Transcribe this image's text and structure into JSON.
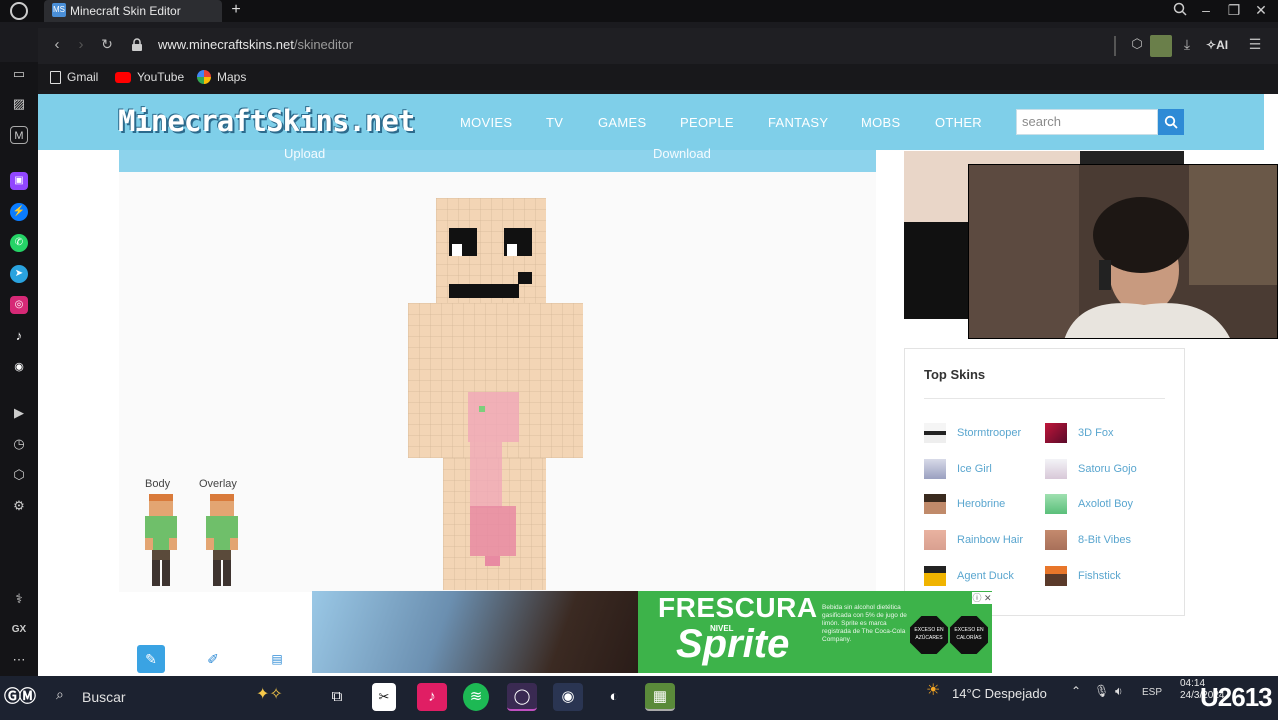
{
  "browser": {
    "tab_title": "Minecraft Skin Editor",
    "tab_favicon": "MS",
    "new_tab": "+",
    "url_domain": "www.minecraftskins.net",
    "url_path": "/skineditor",
    "ai_label": "AI",
    "bookmarks": [
      {
        "label": "Gmail",
        "color": "#d9d9d9"
      },
      {
        "label": "YouTube",
        "color": "#ff0000"
      },
      {
        "label": "Maps",
        "color": "#34a853"
      }
    ]
  },
  "site": {
    "logo": "MinecraftSkins.net",
    "nav": [
      "MOVIES",
      "TV",
      "GAMES",
      "PEOPLE",
      "FANTASY",
      "MOBS",
      "OTHER"
    ],
    "search_placeholder": "search",
    "accent": "#7fcfe9",
    "search_button_color": "#2e8bd6"
  },
  "editor": {
    "upload_label": "Upload",
    "download_label": "Download",
    "body_label": "Body",
    "overlay_label": "Overlay",
    "tools": [
      "paint-brush",
      "pencil",
      "eraser"
    ]
  },
  "top_skins": {
    "title": "Top Skins",
    "left": [
      "Stormtrooper",
      "Ice Girl",
      "Herobrine",
      "Rainbow Hair",
      "Agent Duck"
    ],
    "right": [
      "3D Fox",
      "Satoru Gojo",
      "Axolotl Boy",
      "8-Bit Vibes",
      "Fishstick"
    ],
    "link_color": "#5aa6cf"
  },
  "ad": {
    "headline": "FRESCURA",
    "nivel": "NIVEL",
    "brand": "Sprite",
    "fine_print": "Bebida sin alcohol dietética gasificada con 5% de jugo de limón. Sprite es marca registrada de The Coca-Cola Company.",
    "badge_1": "EXCESO EN AZÚCARES",
    "badge_2": "EXCESO EN CALORÍAS"
  },
  "taskbar": {
    "search_label": "Buscar",
    "weather": "14°C  Despejado",
    "language": "ESP",
    "time": "04:14",
    "date": "24/3/2024",
    "watermark": "U2613"
  }
}
